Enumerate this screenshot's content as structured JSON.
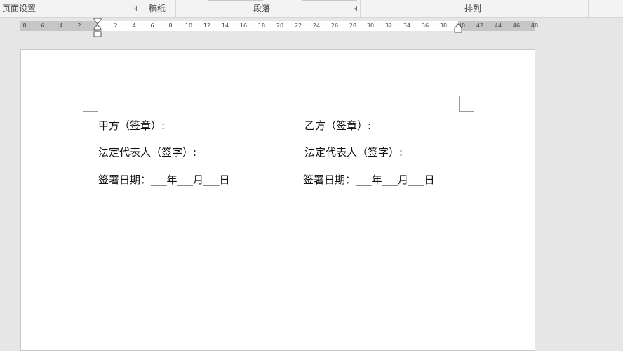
{
  "ribbon": {
    "groups": [
      {
        "label": "页面设置",
        "has_launcher": true
      },
      {
        "label": "稿纸",
        "has_launcher": false
      },
      {
        "label": "段落",
        "has_launcher": true
      },
      {
        "label": "排列",
        "has_launcher": false
      }
    ]
  },
  "ruler": {
    "ticks": [
      "8",
      "6",
      "4",
      "2",
      "2",
      "4",
      "6",
      "8",
      "10",
      "12",
      "14",
      "16",
      "18",
      "20",
      "22",
      "24",
      "26",
      "28",
      "30",
      "32",
      "34",
      "36",
      "38",
      "40",
      "42",
      "44",
      "46",
      "48"
    ]
  },
  "document": {
    "party_a_seal": "甲方（签章）:",
    "party_b_seal": "乙方（签章）:",
    "party_a_rep": "法定代表人（签字）:",
    "party_b_rep": "法定代表人（签字）:",
    "party_a_date": "签署日期：___年___月___日",
    "party_b_date": "签署日期：___年___月___日"
  }
}
